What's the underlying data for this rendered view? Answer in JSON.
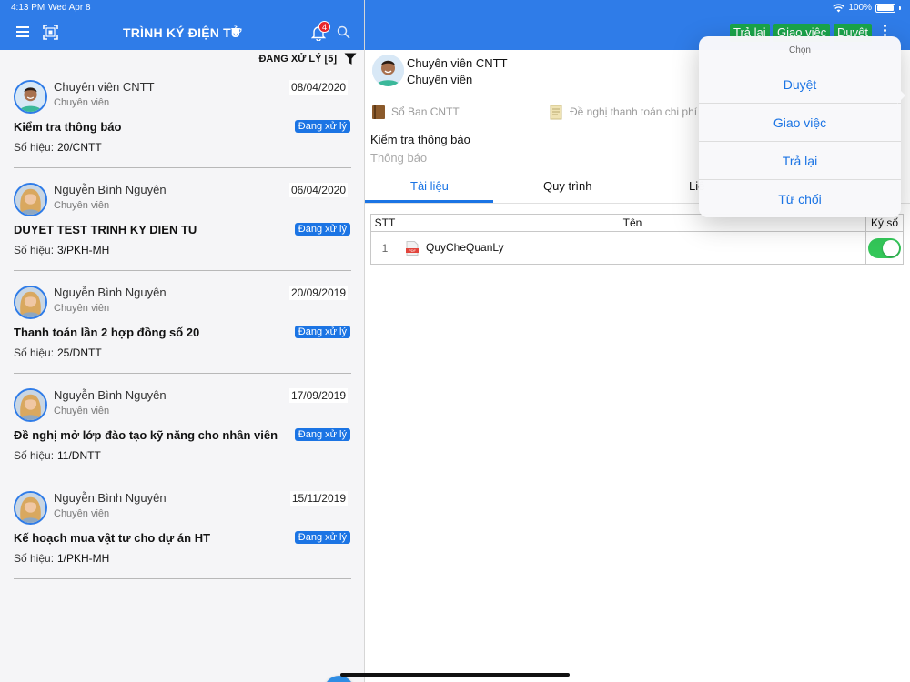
{
  "status_bar": {
    "time": "4:13 PM",
    "date": "Wed Apr 8",
    "battery": "100%"
  },
  "header": {
    "title": "TRÌNH KÝ ĐIỆN TỬ",
    "notification_count": "4",
    "actions": {
      "return": "Trả lại",
      "assign": "Giao việc",
      "approve": "Duyệt"
    }
  },
  "list": {
    "filter_label": "ĐANG XỬ LÝ [5]",
    "docno_label": "Số hiệu:",
    "items": [
      {
        "name": "Chuyên viên CNTT",
        "role": "Chuyên viên",
        "date": "08/04/2020",
        "subject": "Kiểm tra thông báo",
        "status": "Đang xử lý",
        "docno": "20/CNTT"
      },
      {
        "name": "Nguyễn Bình Nguyên",
        "role": "Chuyên viên",
        "date": "06/04/2020",
        "subject": "DUYET TEST TRINH KY DIEN TU",
        "status": "Đang xử lý",
        "docno": "3/PKH-MH"
      },
      {
        "name": "Nguyễn Bình Nguyên",
        "role": "Chuyên viên",
        "date": "20/09/2019",
        "subject": "Thanh toán lần 2 hợp đồng số 20",
        "status": "Đang xử lý",
        "docno": "25/DNTT"
      },
      {
        "name": "Nguyễn Bình Nguyên",
        "role": "Chuyên viên",
        "date": "17/09/2019",
        "subject": "Đề nghị mở lớp đào tạo kỹ năng cho nhân viên",
        "status": "Đang xử lý",
        "docno": "11/DNTT"
      },
      {
        "name": "Nguyễn Bình Nguyên",
        "role": "Chuyên viên",
        "date": "15/11/2019",
        "subject": "Kế hoạch mua vật tư cho dự án HT",
        "status": "Đang xử lý",
        "docno": "1/PKH-MH"
      }
    ]
  },
  "detail": {
    "sender_name": "Chuyên viên CNTT",
    "sender_role": "Chuyên viên",
    "book": "Sổ Ban CNTT",
    "doc_type": "Đề nghị thanh toán chi phí",
    "subject": "Kiểm tra thông báo",
    "category": "Thông báo",
    "tabs": [
      "Tài liệu",
      "Quy trình",
      "Liê"
    ],
    "table": {
      "headers": {
        "stt": "STT",
        "name": "Tên",
        "sign": "Ký số"
      },
      "rows": [
        {
          "stt": "1",
          "file": "QuyCheQuanLy",
          "signed": true
        }
      ]
    }
  },
  "popover": {
    "title": "Chọn",
    "items": [
      "Duyệt",
      "Giao việc",
      "Trả lại",
      "Từ chối"
    ]
  },
  "colors": {
    "primary": "#2f7ce8",
    "action_green": "#1aa54a",
    "badge_blue": "#1b74e4",
    "toggle_on": "#34c759"
  }
}
